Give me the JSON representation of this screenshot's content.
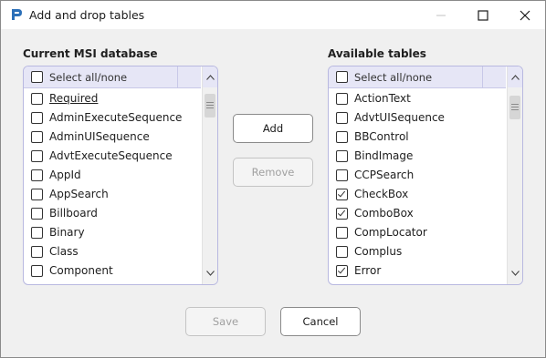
{
  "window": {
    "title": "Add and drop tables"
  },
  "left_panel": {
    "heading": "Current MSI database",
    "select_all": "Select all/none",
    "items": [
      {
        "label": "Required",
        "checked": false
      },
      {
        "label": "AdminExecuteSequence",
        "checked": false
      },
      {
        "label": "AdminUISequence",
        "checked": false
      },
      {
        "label": "AdvtExecuteSequence",
        "checked": false
      },
      {
        "label": "AppId",
        "checked": false
      },
      {
        "label": "AppSearch",
        "checked": false
      },
      {
        "label": "Billboard",
        "checked": false
      },
      {
        "label": "Binary",
        "checked": false
      },
      {
        "label": "Class",
        "checked": false
      },
      {
        "label": "Component",
        "checked": false
      }
    ]
  },
  "right_panel": {
    "heading": "Available tables",
    "select_all": "Select all/none",
    "items": [
      {
        "label": "ActionText",
        "checked": false
      },
      {
        "label": "AdvtUISequence",
        "checked": false
      },
      {
        "label": "BBControl",
        "checked": false
      },
      {
        "label": "BindImage",
        "checked": false
      },
      {
        "label": "CCPSearch",
        "checked": false
      },
      {
        "label": "CheckBox",
        "checked": true
      },
      {
        "label": "ComboBox",
        "checked": true
      },
      {
        "label": "CompLocator",
        "checked": false
      },
      {
        "label": "Complus",
        "checked": false
      },
      {
        "label": "Error",
        "checked": true
      }
    ]
  },
  "buttons": {
    "add": "Add",
    "remove": "Remove",
    "save": "Save",
    "cancel": "Cancel"
  },
  "colors": {
    "accent": "#2b6fb8",
    "header_bg": "#e6e6f6",
    "list_border": "#b8b8e0"
  }
}
